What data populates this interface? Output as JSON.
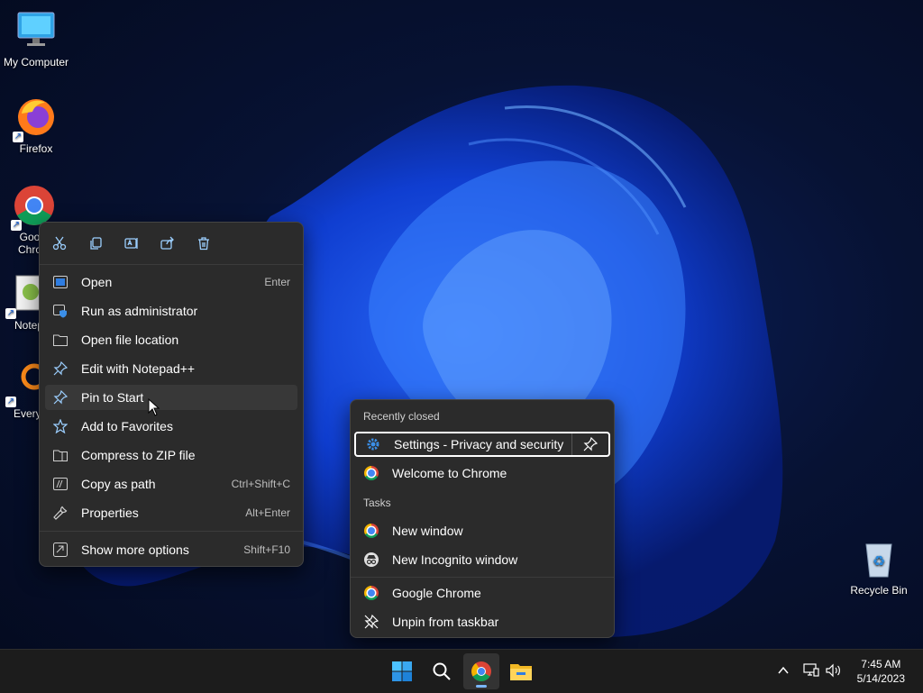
{
  "desktop": {
    "icons": [
      {
        "label": "My Computer"
      },
      {
        "label": "Firefox"
      },
      {
        "label": "Goo\nChro"
      },
      {
        "label": "Notep"
      },
      {
        "label": "Everyt"
      },
      {
        "label": "Recycle Bin"
      }
    ]
  },
  "context_menu": {
    "toolbar": [
      "cut-icon",
      "copy-icon",
      "rename-icon",
      "share-icon",
      "delete-icon"
    ],
    "items": [
      {
        "label": "Open",
        "shortcut": "Enter"
      },
      {
        "label": "Run as administrator",
        "shortcut": ""
      },
      {
        "label": "Open file location",
        "shortcut": ""
      },
      {
        "label": "Edit with Notepad++",
        "shortcut": ""
      },
      {
        "label": "Pin to Start",
        "shortcut": ""
      },
      {
        "label": "Add to Favorites",
        "shortcut": ""
      },
      {
        "label": "Compress to ZIP file",
        "shortcut": ""
      },
      {
        "label": "Copy as path",
        "shortcut": "Ctrl+Shift+C"
      },
      {
        "label": "Properties",
        "shortcut": "Alt+Enter"
      },
      {
        "label": "Show more options",
        "shortcut": "Shift+F10"
      }
    ]
  },
  "jump_list": {
    "recent_header": "Recently closed",
    "recent": [
      {
        "label": "Settings - Privacy and security"
      },
      {
        "label": "Welcome to Chrome"
      }
    ],
    "tasks_header": "Tasks",
    "tasks": [
      {
        "label": "New window"
      },
      {
        "label": "New Incognito window"
      }
    ],
    "app": [
      {
        "label": "Google Chrome"
      },
      {
        "label": "Unpin from taskbar"
      }
    ]
  },
  "taskbar": {
    "time": "7:45 AM",
    "date": "5/14/2023",
    "apps": [
      "start-icon",
      "search-icon",
      "chrome-icon",
      "file-explorer-icon"
    ]
  },
  "colors": {
    "accent": "#1a5fd0",
    "menu_bg": "#2b2b2b",
    "taskbar_bg": "#1c1c1c"
  }
}
